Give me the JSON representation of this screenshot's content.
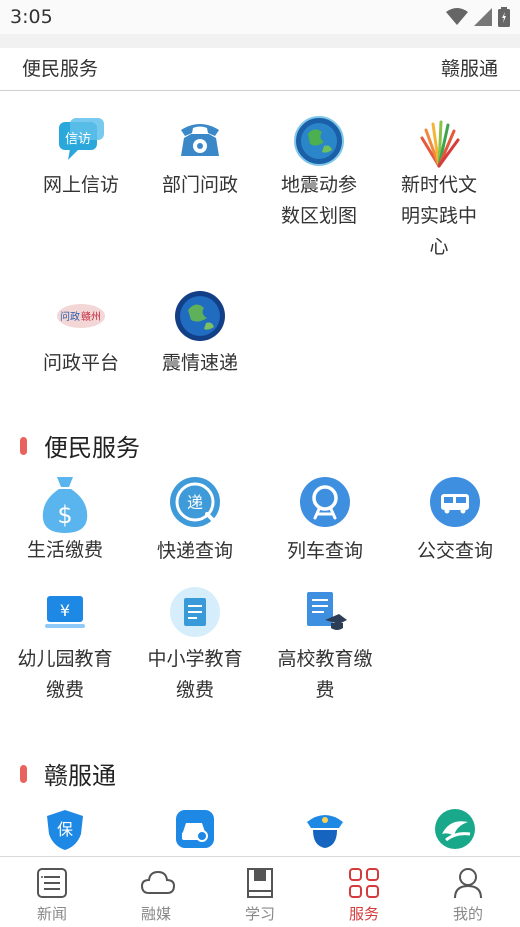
{
  "status": {
    "time": "3:05"
  },
  "tabs": {
    "left": "便民服务",
    "right": "赣服通"
  },
  "grid1": [
    {
      "label": "网上信访",
      "icon": "xinfang-icon"
    },
    {
      "label": "部门问政",
      "icon": "telephone-icon"
    },
    {
      "label": "地震动参数区划图",
      "icon": "earth-icon"
    },
    {
      "label": "新时代文明实践中心",
      "icon": "fan-logo-icon"
    },
    {
      "label": "问政平台",
      "icon": "wenzheng-ganzhou-icon"
    },
    {
      "label": "震情速递",
      "icon": "earth-icon"
    }
  ],
  "grid1_lines": {
    "c0": [
      "网上信访"
    ],
    "c1": [
      "部门问政"
    ],
    "c2": [
      "地震动参",
      "数区划图"
    ],
    "c3": [
      "新时代文",
      "明实践中",
      "心"
    ],
    "c4": [
      "问政平台"
    ],
    "c5": [
      "震情速递"
    ]
  },
  "section_bianmin": {
    "title": "便民服务",
    "items": [
      {
        "label1": "生活缴费",
        "label2": "",
        "icon": "money-bag-icon"
      },
      {
        "label1": "快递查询",
        "label2": "",
        "icon": "express-delivery-icon"
      },
      {
        "label1": "列车查询",
        "label2": "",
        "icon": "train-icon"
      },
      {
        "label1": "公交查询",
        "label2": "",
        "icon": "bus-icon"
      },
      {
        "label1": "幼儿园教育",
        "label2": "缴费",
        "icon": "yuan-payment-icon"
      },
      {
        "label1": "中小学教育",
        "label2": "缴费",
        "icon": "notebook-icon"
      },
      {
        "label1": "高校教育缴",
        "label2": "费",
        "icon": "graduation-doc-icon"
      }
    ]
  },
  "section_ganfutong": {
    "title": "赣服通",
    "items": [
      {
        "label": "保",
        "icon": "insurance-shield-icon"
      },
      {
        "label": "",
        "icon": "car-search-icon"
      },
      {
        "label": "",
        "icon": "police-icon"
      },
      {
        "label": "",
        "icon": "green-logo-icon"
      }
    ]
  },
  "bottom_nav": [
    {
      "label": "新闻",
      "icon": "news-icon",
      "active": false
    },
    {
      "label": "融媒",
      "icon": "cloud-icon",
      "active": false
    },
    {
      "label": "学习",
      "icon": "book-icon",
      "active": false
    },
    {
      "label": "服务",
      "icon": "grid-icon",
      "active": true
    },
    {
      "label": "我的",
      "icon": "person-icon",
      "active": false
    }
  ],
  "colors": {
    "accent": "#d63b3b",
    "section_bar": "#e9635e",
    "icon_blue": "#3a8ee6"
  }
}
